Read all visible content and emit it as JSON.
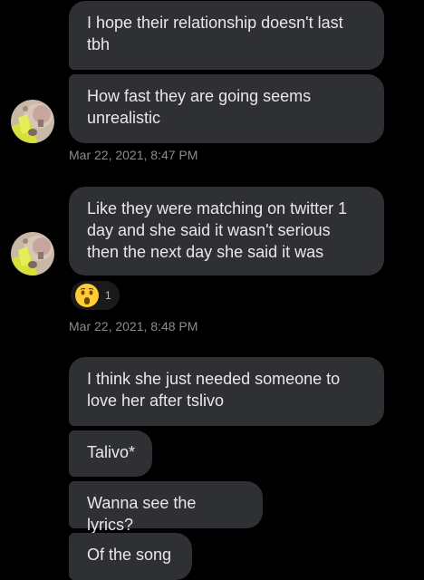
{
  "messages": [
    {
      "text": "I hope their relationship doesn't last tbh"
    },
    {
      "text": "How fast they are going seems unrealistic"
    },
    {
      "text": "Like they were matching on twitter 1 day and she said it wasn't serious then the next day she said it was"
    },
    {
      "text": "I think she just needed someone to love her after tslivo"
    },
    {
      "text": "Talivo*"
    },
    {
      "text": "Wanna see the lyrics?"
    },
    {
      "text": "Of the song"
    }
  ],
  "timestamps": [
    "Mar 22, 2021, 8:47 PM",
    "Mar 22, 2021, 8:48 PM"
  ],
  "reaction": {
    "emoji": "astonished-face-icon",
    "count": "1"
  },
  "colors": {
    "bubble": "#2f3033",
    "background": "#000000",
    "text": "#e8e8e8",
    "timestamp": "#8c8c8c"
  }
}
